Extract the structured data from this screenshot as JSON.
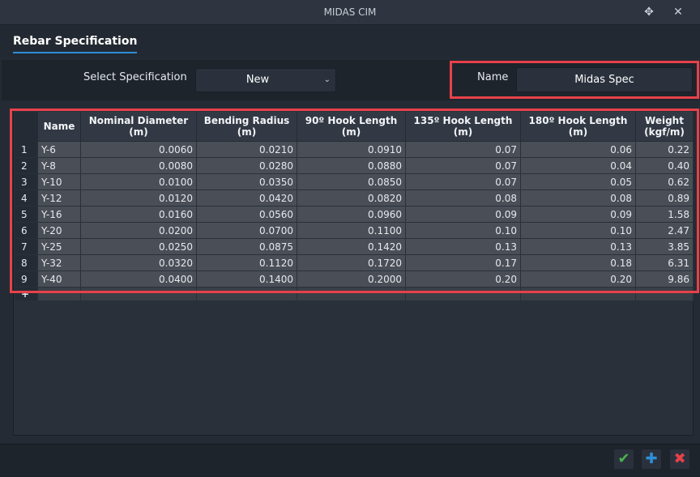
{
  "window": {
    "title": "MIDAS CIM",
    "pin_icon": "move-icon",
    "close_icon": "close-icon"
  },
  "tab": {
    "label": "Rebar Specification"
  },
  "filter": {
    "select_label": "Select Specification",
    "select_value": "New",
    "name_label": "Name",
    "name_value": "Midas Spec"
  },
  "table": {
    "headers": [
      {
        "l1": "Name",
        "l2": ""
      },
      {
        "l1": "Nominal Diameter",
        "l2": "(m)"
      },
      {
        "l1": "Bending Radius",
        "l2": "(m)"
      },
      {
        "l1": "90º Hook Length",
        "l2": "(m)"
      },
      {
        "l1": "135º Hook Length",
        "l2": "(m)"
      },
      {
        "l1": "180º Hook Length",
        "l2": "(m)"
      },
      {
        "l1": "Weight",
        "l2": "(kgf/m)"
      }
    ],
    "rows": [
      [
        "1",
        "Y-6",
        "0.0060",
        "0.0210",
        "0.0910",
        "0.07",
        "0.06",
        "0.22"
      ],
      [
        "2",
        "Y-8",
        "0.0080",
        "0.0280",
        "0.0880",
        "0.07",
        "0.04",
        "0.40"
      ],
      [
        "3",
        "Y-10",
        "0.0100",
        "0.0350",
        "0.0850",
        "0.07",
        "0.05",
        "0.62"
      ],
      [
        "4",
        "Y-12",
        "0.0120",
        "0.0420",
        "0.0820",
        "0.08",
        "0.08",
        "0.89"
      ],
      [
        "5",
        "Y-16",
        "0.0160",
        "0.0560",
        "0.0960",
        "0.09",
        "0.09",
        "1.58"
      ],
      [
        "6",
        "Y-20",
        "0.0200",
        "0.0700",
        "0.1100",
        "0.10",
        "0.10",
        "2.47"
      ],
      [
        "7",
        "Y-25",
        "0.0250",
        "0.0875",
        "0.1420",
        "0.13",
        "0.13",
        "3.85"
      ],
      [
        "8",
        "Y-32",
        "0.0320",
        "0.1120",
        "0.1720",
        "0.17",
        "0.18",
        "6.31"
      ],
      [
        "9",
        "Y-40",
        "0.0400",
        "0.1400",
        "0.2000",
        "0.20",
        "0.20",
        "9.86"
      ]
    ],
    "new_row_marker": "+"
  },
  "footer": {
    "confirm_icon": "checkmark-icon",
    "add_icon": "plus-icon",
    "delete_icon": "x-icon",
    "confirm_color": "#4caf50",
    "add_color": "#2f8fd6",
    "delete_color": "#e8414a"
  },
  "highlight_color": "#e8414a"
}
